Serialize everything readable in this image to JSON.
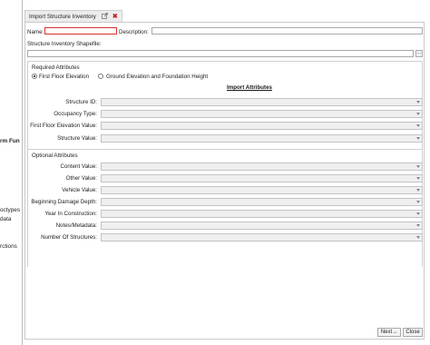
{
  "background_fragments": [
    {
      "text": "rm Fun",
      "bold": true
    },
    {
      "text": "octypes",
      "bold": false
    },
    {
      "text": "data",
      "bold": false
    },
    {
      "text": "rctions",
      "bold": false
    }
  ],
  "tab": {
    "title": "Import Structure Inventory",
    "popout_icon": "popout-icon",
    "close_glyph": "✖"
  },
  "form": {
    "name_label": "Name:",
    "name_value": "",
    "description_label": "Description:",
    "description_value": "",
    "shapefile_label": "Structure Inventory Shapefile:",
    "shapefile_value": "",
    "browse_label": "..."
  },
  "required": {
    "title": "Required Attributes",
    "radio_first_floor": "First Floor Elevation",
    "radio_ground": "Ground Elevation and Foundation Height",
    "selected": "first_floor",
    "section_title": "Import Attributes",
    "fields": [
      {
        "label": "Structure ID:",
        "value": ""
      },
      {
        "label": "Occupancy Type:",
        "value": ""
      },
      {
        "label": "First Floor Elevation Value:",
        "value": ""
      },
      {
        "label": "Structure Value:",
        "value": ""
      }
    ]
  },
  "optional": {
    "title": "Optional Attributes",
    "fields": [
      {
        "label": "Content Value:",
        "value": ""
      },
      {
        "label": "Other Value:",
        "value": ""
      },
      {
        "label": "Vehicle Value:",
        "value": ""
      },
      {
        "label": "Beginning Damage Depth:",
        "value": ""
      },
      {
        "label": "Year In Construction:",
        "value": ""
      },
      {
        "label": "Notes/Metadata:",
        "value": ""
      },
      {
        "label": "Number Of Structures:",
        "value": ""
      }
    ]
  },
  "buttons": {
    "next": "Next→",
    "cancel": "Close"
  },
  "colors": {
    "required_border": "#d9302f",
    "arrow": "#d02b2b",
    "close_icon": "#c0202a"
  }
}
